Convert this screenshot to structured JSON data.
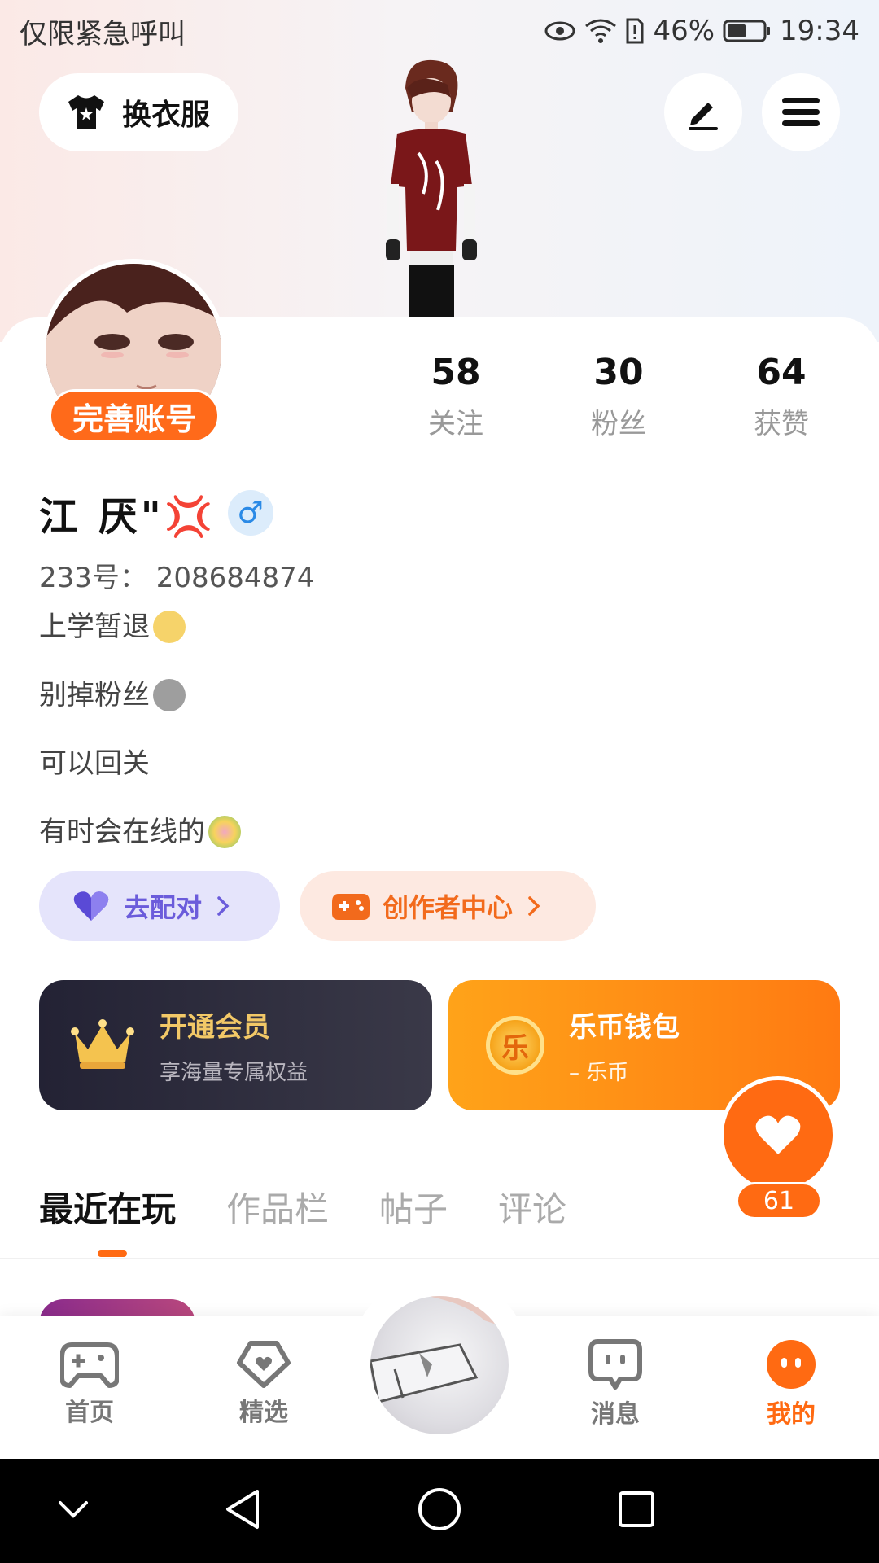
{
  "status_bar": {
    "left_text": "仅限紧急呼叫",
    "battery": "46%",
    "time": "19:34"
  },
  "header": {
    "outfit_label": "换衣服"
  },
  "profile": {
    "complete_badge": "完善账号",
    "stats": [
      {
        "value": "58",
        "label": "关注"
      },
      {
        "value": "30",
        "label": "粉丝"
      },
      {
        "value": "64",
        "label": "获赞"
      }
    ],
    "name": "江 厌\"💢",
    "gender_symbol": "♂",
    "uid": "233号： 208684874",
    "bio": [
      "上学暂退",
      "别掉粉丝",
      "可以回关",
      "有时会在线的"
    ]
  },
  "quick_actions": {
    "match_label": "去配对",
    "creator_label": "创作者中心"
  },
  "cards": {
    "vip_title": "开通会员",
    "vip_sub": "享海量专属权益",
    "wallet_title": "乐币钱包",
    "wallet_sub": "– 乐币",
    "coin_char": "乐"
  },
  "like": {
    "count": "61"
  },
  "tabs": [
    "最近在玩",
    "作品栏",
    "帖子",
    "评论"
  ],
  "bottom_nav": [
    "首页",
    "精选",
    "消息",
    "我的"
  ],
  "colors": {
    "accent": "#ff6a12",
    "match_bg": "#e5e4fb",
    "creator_bg": "#fde9e1",
    "vip_bg": "#232234",
    "wallet_bg": "#ff8a14"
  }
}
